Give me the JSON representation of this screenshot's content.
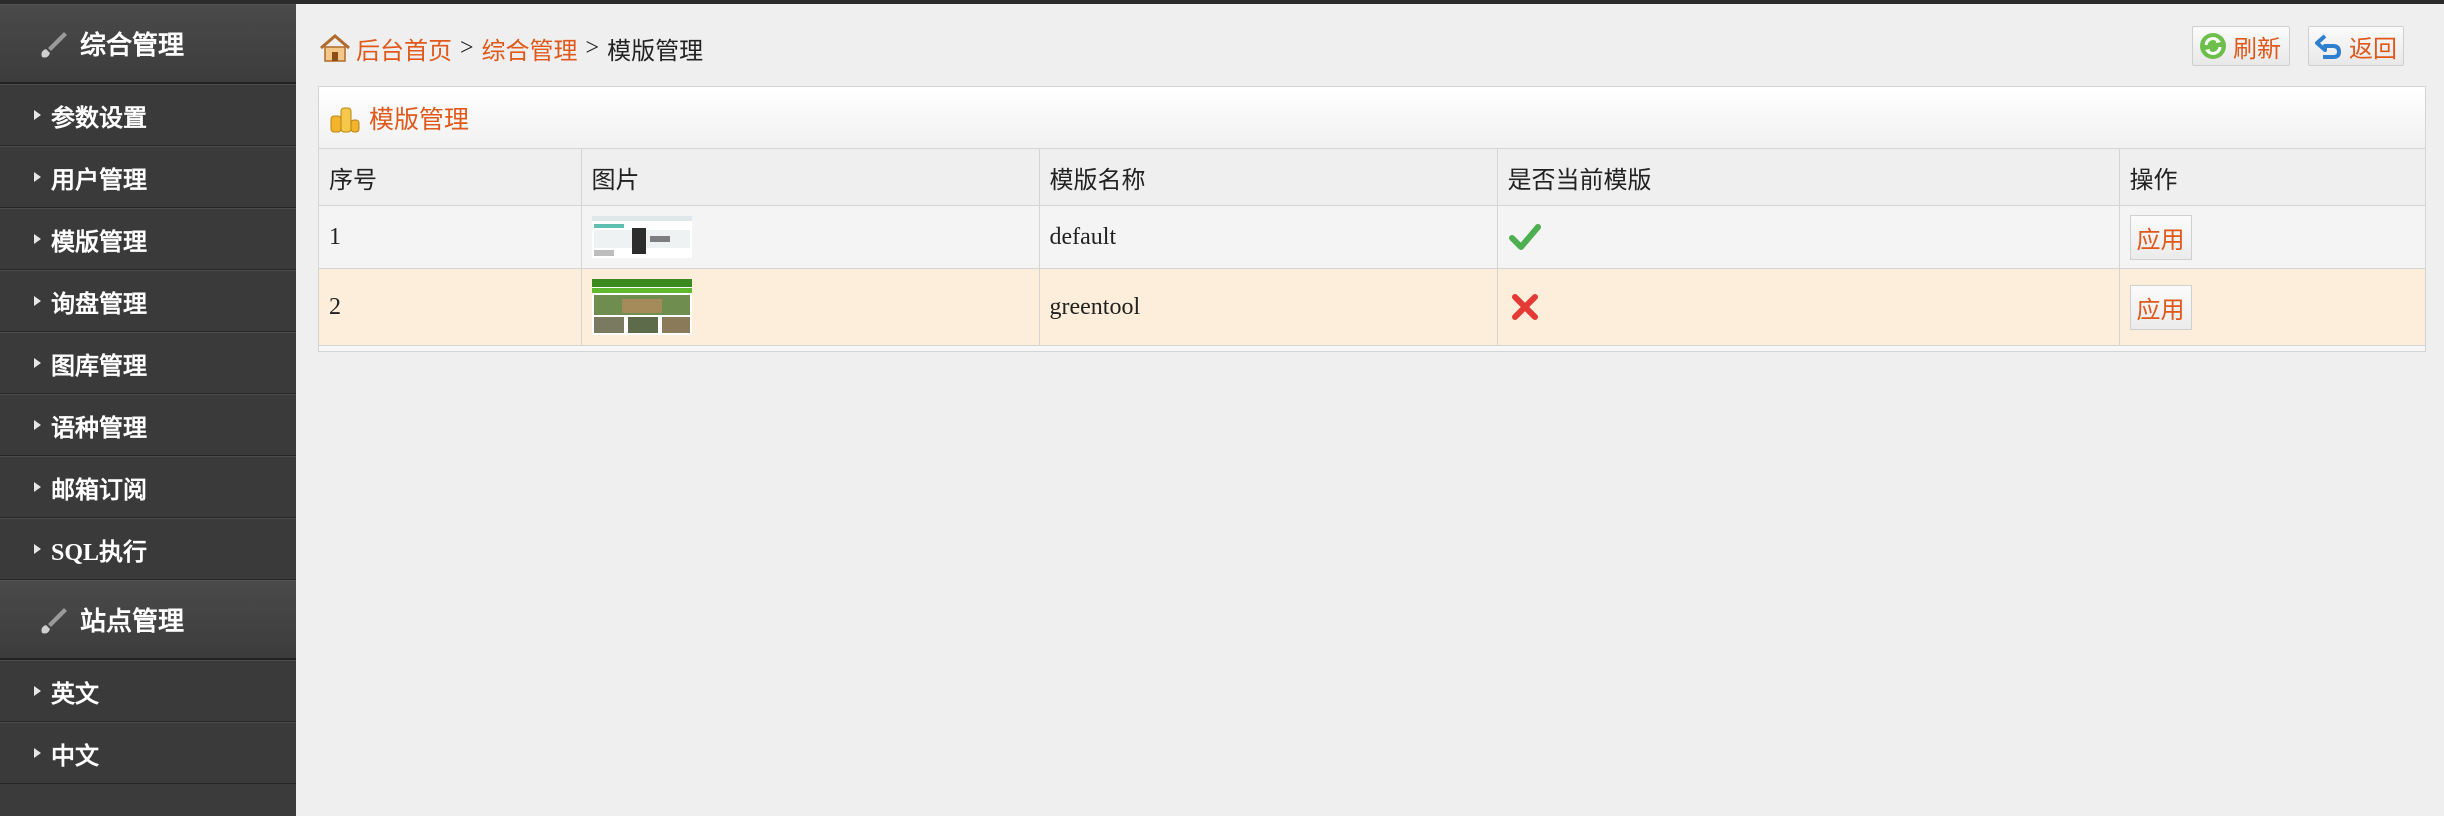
{
  "sidebar": {
    "sections": [
      {
        "title": "综合管理",
        "items": [
          "参数设置",
          "用户管理",
          "模版管理",
          "询盘管理",
          "图库管理",
          "语种管理",
          "邮箱订阅",
          "SQL执行"
        ]
      },
      {
        "title": "站点管理",
        "items": [
          "英文",
          "中文"
        ]
      }
    ]
  },
  "breadcrumb": {
    "home": "后台首页",
    "sep1": ">",
    "section": "综合管理",
    "sep2": ">",
    "current": "模版管理"
  },
  "toolbar": {
    "refresh_label": "刷新",
    "back_label": "返回"
  },
  "panel": {
    "title": "模版管理",
    "columns": [
      "序号",
      "图片",
      "模版名称",
      "是否当前模版",
      "操作"
    ],
    "rows": [
      {
        "index": "1",
        "name": "default",
        "current": true,
        "action": "应用",
        "thumb_theme": "default"
      },
      {
        "index": "2",
        "name": "greentool",
        "current": false,
        "action": "应用",
        "thumb_theme": "green"
      }
    ]
  },
  "colors": {
    "accent": "#e0581a",
    "sidebar_bg": "#3b3b3b",
    "highlight_row": "#fdeedb",
    "check": "#4caf50",
    "cross": "#e53935"
  }
}
